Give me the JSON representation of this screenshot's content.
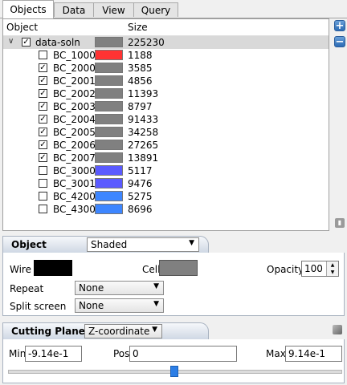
{
  "tabs": [
    {
      "label": "Objects",
      "active": true
    },
    {
      "label": "Data",
      "active": false
    },
    {
      "label": "View",
      "active": false
    },
    {
      "label": "Query",
      "active": false
    }
  ],
  "tree": {
    "header_object": "Object",
    "header_size": "Size",
    "root": {
      "name": "data-soln",
      "checked": true,
      "color": "#808080",
      "size": "225230"
    },
    "items": [
      {
        "name": "BC_1000",
        "checked": false,
        "color": "#ff3333",
        "size": "1188"
      },
      {
        "name": "BC_2000",
        "checked": true,
        "color": "#808080",
        "size": "3585"
      },
      {
        "name": "BC_2001",
        "checked": true,
        "color": "#808080",
        "size": "4856"
      },
      {
        "name": "BC_2002",
        "checked": true,
        "color": "#808080",
        "size": "11393"
      },
      {
        "name": "BC_2003",
        "checked": true,
        "color": "#808080",
        "size": "8797"
      },
      {
        "name": "BC_2004",
        "checked": true,
        "color": "#808080",
        "size": "91433"
      },
      {
        "name": "BC_2005",
        "checked": true,
        "color": "#808080",
        "size": "34258"
      },
      {
        "name": "BC_2006",
        "checked": true,
        "color": "#808080",
        "size": "27265"
      },
      {
        "name": "BC_2007",
        "checked": true,
        "color": "#808080",
        "size": "13891"
      },
      {
        "name": "BC_3000",
        "checked": false,
        "color": "#5a5aff",
        "size": "5117"
      },
      {
        "name": "BC_3001",
        "checked": false,
        "color": "#5a5aff",
        "size": "9476"
      },
      {
        "name": "BC_4200",
        "checked": false,
        "color": "#3d86ff",
        "size": "5275"
      },
      {
        "name": "BC_4300",
        "checked": false,
        "color": "#3d86ff",
        "size": "8696"
      }
    ]
  },
  "side_buttons": {
    "add": "+",
    "remove": "−"
  },
  "object_section": {
    "title": "Object",
    "mode": "Shaded",
    "wire_label": "Wire",
    "wire_color": "#000000",
    "cell_label": "Cell",
    "cell_color": "#808080",
    "opacity_label": "Opacity",
    "opacity_value": "100",
    "repeat_label": "Repeat",
    "repeat_value": "None",
    "split_label": "Split screen",
    "split_value": "None"
  },
  "cutting_section": {
    "title": "Cutting Plane",
    "coordinate": "Z-coordinate",
    "min_label": "Min",
    "min_value": "-9.14e-1",
    "pos_label": "Pos",
    "pos_value": "0",
    "max_label": "Max",
    "max_value": "9.14e-1",
    "slider_fraction": 0.5
  }
}
